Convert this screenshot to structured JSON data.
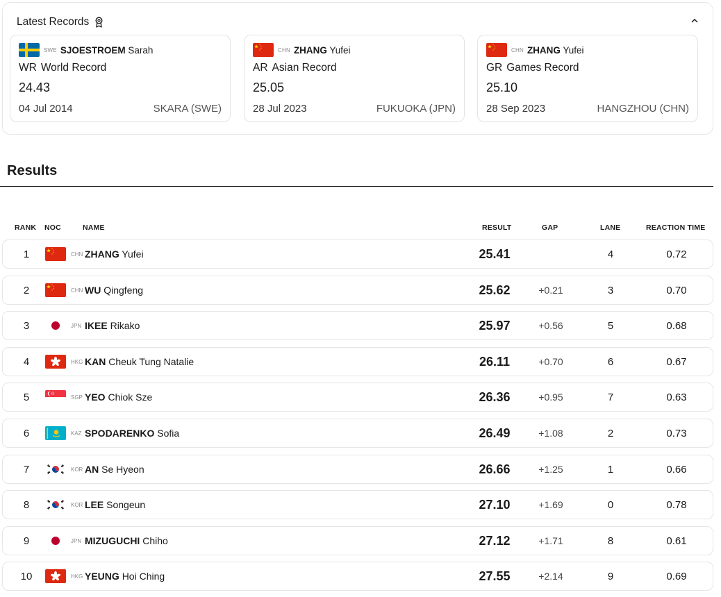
{
  "records": {
    "title": "Latest Records",
    "cards": [
      {
        "flag": "swe",
        "noc": "SWE",
        "family": "SJOESTROEM",
        "given": "Sarah",
        "code": "WR",
        "label": "World Record",
        "time": "24.43",
        "date": "04 Jul 2014",
        "place": "SKARA (SWE)"
      },
      {
        "flag": "chn",
        "noc": "CHN",
        "family": "ZHANG",
        "given": "Yufei",
        "code": "AR",
        "label": "Asian Record",
        "time": "25.05",
        "date": "28 Jul 2023",
        "place": "FUKUOKA (JPN)"
      },
      {
        "flag": "chn",
        "noc": "CHN",
        "family": "ZHANG",
        "given": "Yufei",
        "code": "GR",
        "label": "Games Record",
        "time": "25.10",
        "date": "28 Sep 2023",
        "place": "HANGZHOU (CHN)"
      }
    ]
  },
  "results": {
    "title": "Results",
    "headers": {
      "rank": "RANK",
      "noc": "NOC",
      "name": "NAME",
      "result": "RESULT",
      "gap": "GAP",
      "lane": "LANE",
      "reaction": "REACTION TIME"
    },
    "rows": [
      {
        "rank": "1",
        "flag": "chn",
        "noc": "CHN",
        "family": "ZHANG",
        "given": "Yufei",
        "result": "25.41",
        "gap": "",
        "lane": "4",
        "reaction": "0.72"
      },
      {
        "rank": "2",
        "flag": "chn",
        "noc": "CHN",
        "family": "WU",
        "given": "Qingfeng",
        "result": "25.62",
        "gap": "+0.21",
        "lane": "3",
        "reaction": "0.70"
      },
      {
        "rank": "3",
        "flag": "jpn",
        "noc": "JPN",
        "family": "IKEE",
        "given": "Rikako",
        "result": "25.97",
        "gap": "+0.56",
        "lane": "5",
        "reaction": "0.68"
      },
      {
        "rank": "4",
        "flag": "hkg",
        "noc": "HKG",
        "family": "KAN",
        "given": "Cheuk Tung Natalie",
        "result": "26.11",
        "gap": "+0.70",
        "lane": "6",
        "reaction": "0.67"
      },
      {
        "rank": "5",
        "flag": "sgp",
        "noc": "SGP",
        "family": "YEO",
        "given": "Chiok Sze",
        "result": "26.36",
        "gap": "+0.95",
        "lane": "7",
        "reaction": "0.63"
      },
      {
        "rank": "6",
        "flag": "kaz",
        "noc": "KAZ",
        "family": "SPODARENKO",
        "given": "Sofia",
        "result": "26.49",
        "gap": "+1.08",
        "lane": "2",
        "reaction": "0.73"
      },
      {
        "rank": "7",
        "flag": "kor",
        "noc": "KOR",
        "family": "AN",
        "given": "Se Hyeon",
        "result": "26.66",
        "gap": "+1.25",
        "lane": "1",
        "reaction": "0.66"
      },
      {
        "rank": "8",
        "flag": "kor",
        "noc": "KOR",
        "family": "LEE",
        "given": "Songeun",
        "result": "27.10",
        "gap": "+1.69",
        "lane": "0",
        "reaction": "0.78"
      },
      {
        "rank": "9",
        "flag": "jpn",
        "noc": "JPN",
        "family": "MIZUGUCHI",
        "given": "Chiho",
        "result": "27.12",
        "gap": "+1.71",
        "lane": "8",
        "reaction": "0.61"
      },
      {
        "rank": "10",
        "flag": "hkg",
        "noc": "HKG",
        "family": "YEUNG",
        "given": "Hoi Ching",
        "result": "27.55",
        "gap": "+2.14",
        "lane": "9",
        "reaction": "0.69"
      }
    ]
  },
  "icons": {
    "medal": "medal-icon",
    "collapse": "chevron-up-icon"
  },
  "colors": {
    "china_red": "#de2910",
    "japan_red": "#bc002d",
    "hongkong_red": "#de2910",
    "sweden_blue": "#006aa7",
    "sweden_yellow": "#fecc00",
    "kazakh_blue": "#00afca",
    "kazakh_gold": "#fec50c",
    "korea_red": "#cd2e3a",
    "korea_blue": "#0047a0"
  }
}
